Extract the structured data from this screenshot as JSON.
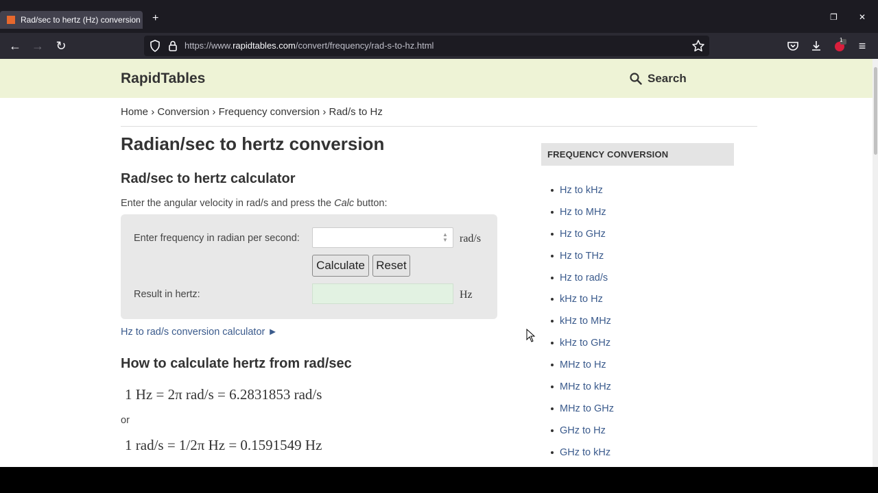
{
  "browser": {
    "tab_title": "Rad/sec to hertz (Hz) conversion",
    "url_prefix": "https://www.",
    "url_domain": "rapidtables.com",
    "url_path": "/convert/frequency/rad-s-to-hz.html",
    "pocket_badge": "1"
  },
  "site": {
    "logo": "RapidTables",
    "search_label": "Search"
  },
  "breadcrumb": [
    "Home",
    "›",
    "Conversion",
    "›",
    "Frequency conversion",
    "›",
    "Rad/s to Hz"
  ],
  "main": {
    "title": "Radian/sec to hertz conversion",
    "calc_heading": "Rad/sec to hertz calculator",
    "intro_before": "Enter the angular velocity in rad/s and press the ",
    "intro_italic": "Calc",
    "intro_after": " button:",
    "calculator": {
      "input_label": "Enter frequency in radian per second:",
      "input_value": "",
      "input_unit": "rad/s",
      "calculate_label": "Calculate",
      "reset_label": "Reset",
      "result_label": "Result in hertz:",
      "result_value": "",
      "result_unit": "Hz"
    },
    "reverse_link": "Hz to rad/s conversion calculator ►",
    "how_heading": "How to calculate hertz from rad/sec",
    "formula1": "1 Hz = 2π rad/s = 6.2831853 rad/s",
    "or_text": "or",
    "formula2": "1 rad/s = 1/2π Hz = 0.1591549 Hz"
  },
  "sidebar": {
    "heading": "FREQUENCY CONVERSION",
    "items": [
      {
        "label": "Hz to kHz"
      },
      {
        "label": "Hz to MHz"
      },
      {
        "label": "Hz to GHz"
      },
      {
        "label": "Hz to THz"
      },
      {
        "label": "Hz to rad/s"
      },
      {
        "label": "kHz to Hz"
      },
      {
        "label": "kHz to MHz"
      },
      {
        "label": "kHz to GHz"
      },
      {
        "label": "MHz to Hz"
      },
      {
        "label": "MHz to kHz"
      },
      {
        "label": "MHz to GHz"
      },
      {
        "label": "GHz to Hz"
      },
      {
        "label": "GHz to kHz"
      }
    ]
  },
  "colors": {
    "header_bg": "#eef3d6",
    "link": "#3a5a8c",
    "result_bg": "#e2f2e2"
  }
}
